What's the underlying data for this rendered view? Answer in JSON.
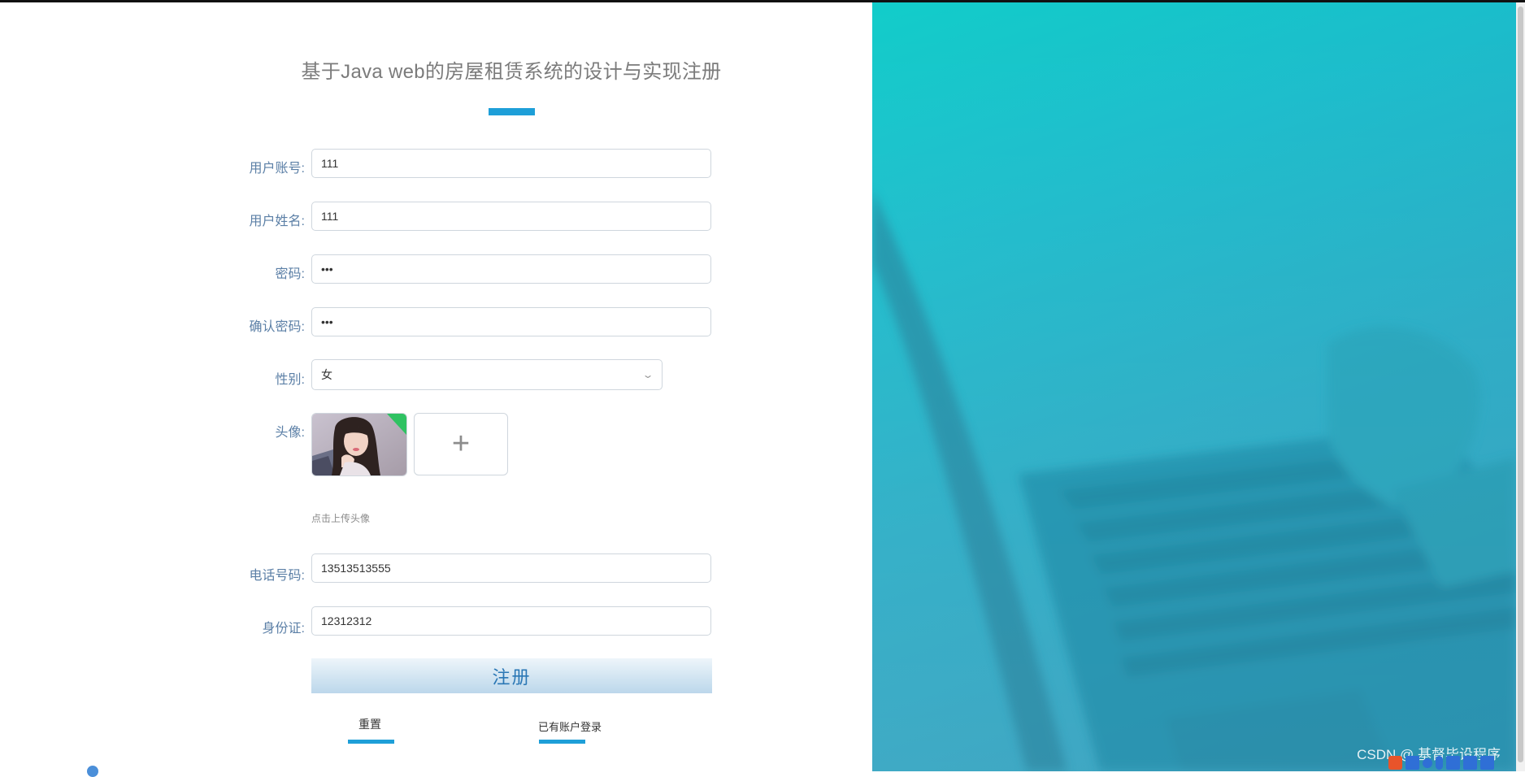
{
  "page": {
    "title": "基于Java web的房屋租赁系统的设计与实现注册"
  },
  "form": {
    "username": {
      "label": "用户账号:",
      "value": "111"
    },
    "fullname": {
      "label": "用户姓名:",
      "value": "111"
    },
    "password": {
      "label": "密码:",
      "value": "•••"
    },
    "confirm_password": {
      "label": "确认密码:",
      "value": "•••"
    },
    "gender": {
      "label": "性别:",
      "value": "女"
    },
    "avatar": {
      "label": "头像:",
      "upload_icon": "+",
      "tip": "点击上传头像"
    },
    "phone": {
      "label": "电话号码:",
      "value": "13513513555"
    },
    "id_card": {
      "label": "身份证:",
      "value": "12312312"
    }
  },
  "actions": {
    "submit_label": "注册",
    "reset_label": "重置",
    "login_link_label": "已有账户登录"
  },
  "watermark": "CSDN @ 基督毕设程序",
  "colors": {
    "accent": "#1e9fd8",
    "label": "#5b7fa6",
    "panel_gradient_start": "#12cdca",
    "panel_gradient_end": "#2694b7"
  },
  "icons": {
    "select_chevron": "chevron-down-icon",
    "upload_plus": "plus-icon"
  }
}
